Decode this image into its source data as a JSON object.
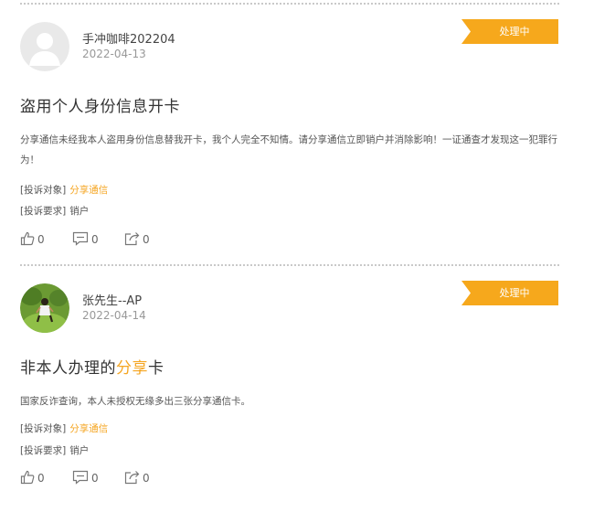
{
  "colors": {
    "accent": "#f5a623",
    "badge": "#f6a81c",
    "divider": "#c9c9c9"
  },
  "posts": [
    {
      "user": "手冲咖啡202204",
      "date": "2022-04-13",
      "avatar": "default-avatar-icon",
      "status": "处理中",
      "title_pre": "盗用个人身份信息开卡",
      "title_hl": "",
      "title_post": "",
      "body": "分享通信未经我本人盗用身份信息替我开卡，我个人完全不知情。请分享通信立即销户并消除影响！一证通查才发现这一犯罪行为！",
      "target_label": "[投诉对象]",
      "target_value": "分享通信",
      "req_label": "[投诉要求]",
      "req_value": "销户",
      "likes": "0",
      "comments": "0",
      "shares": "0"
    },
    {
      "user": "张先生--AP",
      "date": "2022-04-14",
      "avatar": "photo-avatar",
      "status": "处理中",
      "title_pre": "非本人办理的",
      "title_hl": "分享",
      "title_post": "卡",
      "body": "国家反诈查询，本人未授权无缘多出三张分享通信卡。",
      "target_label": "[投诉对象]",
      "target_value": "分享通信",
      "req_label": "[投诉要求]",
      "req_value": "销户",
      "likes": "0",
      "comments": "0",
      "shares": "0"
    }
  ]
}
